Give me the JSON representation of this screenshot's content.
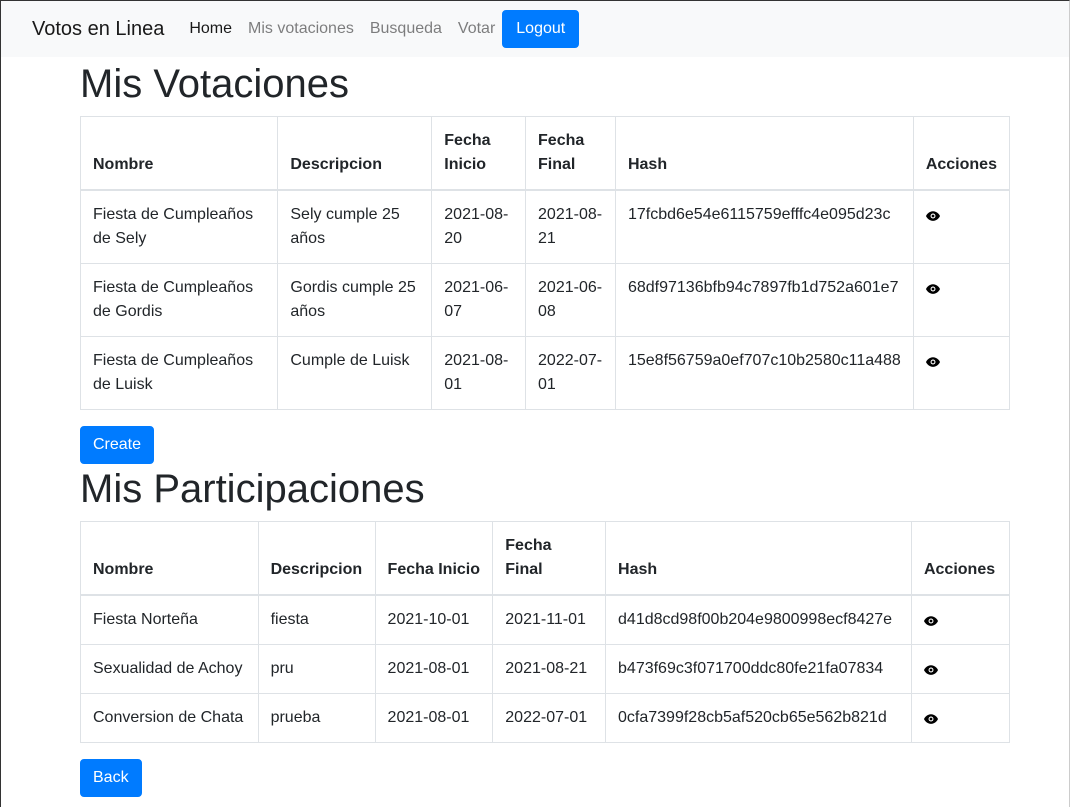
{
  "nav": {
    "brand": "Votos en Linea",
    "links": [
      "Home",
      "Mis votaciones",
      "Busqueda",
      "Votar"
    ],
    "logout": "Logout"
  },
  "votaciones": {
    "title": "Mis Votaciones",
    "headers": [
      "Nombre",
      "Descripcion",
      "Fecha Inicio",
      "Fecha Final",
      "Hash",
      "Acciones"
    ],
    "rows": [
      {
        "nombre": "Fiesta de Cumpleaños de Sely",
        "descripcion": "Sely cumple 25 años",
        "inicio": "2021-08-20",
        "final": "2021-08-21",
        "hash": "17fcbd6e54e6115759efffc4e095d23c"
      },
      {
        "nombre": "Fiesta de Cumpleaños de Gordis",
        "descripcion": "Gordis cumple 25 años",
        "inicio": "2021-06-07",
        "final": "2021-06-08",
        "hash": "68df97136bfb94c7897fb1d752a601e7"
      },
      {
        "nombre": "Fiesta de Cumpleaños de Luisk",
        "descripcion": "Cumple de Luisk",
        "inicio": "2021-08-01",
        "final": "2022-07-01",
        "hash": "15e8f56759a0ef707c10b2580c11a488"
      }
    ],
    "create_label": "Create"
  },
  "participaciones": {
    "title": "Mis Participaciones",
    "headers": [
      "Nombre",
      "Descripcion",
      "Fecha Inicio",
      "Fecha Final",
      "Hash",
      "Acciones"
    ],
    "rows": [
      {
        "nombre": "Fiesta Norteña",
        "descripcion": "fiesta",
        "inicio": "2021-10-01",
        "final": "2021-11-01",
        "hash": "d41d8cd98f00b204e9800998ecf8427e"
      },
      {
        "nombre": "Sexualidad de Achoy",
        "descripcion": "pru",
        "inicio": "2021-08-01",
        "final": "2021-08-21",
        "hash": "b473f69c3f071700ddc80fe21fa07834"
      },
      {
        "nombre": "Conversion de Chata",
        "descripcion": "prueba",
        "inicio": "2021-08-01",
        "final": "2022-07-01",
        "hash": "0cfa7399f28cb5af520cb65e562b821d"
      }
    ],
    "back_label": "Back"
  },
  "colors": {
    "primary": "#007bff",
    "navbar_bg": "#f8f9fa"
  },
  "icons": {
    "view": "eye-icon"
  }
}
